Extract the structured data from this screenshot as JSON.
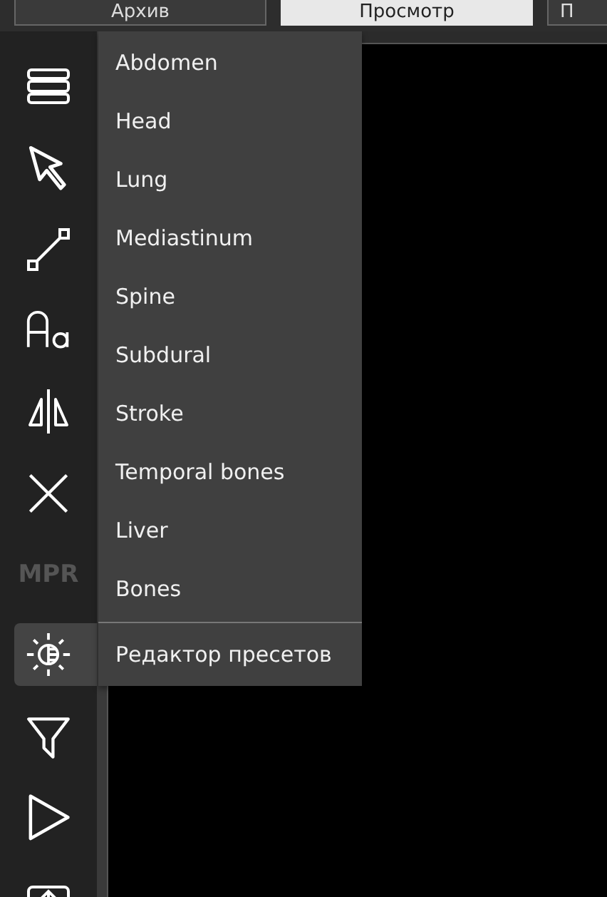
{
  "tabs": [
    {
      "label": "Архив",
      "selected": false
    },
    {
      "label": "Просмотр",
      "selected": true
    },
    {
      "label": "П",
      "selected": false
    }
  ],
  "toolbar": [
    {
      "kind": "icon",
      "selected": false,
      "disabled": false
    },
    {
      "kind": "icon",
      "selected": false,
      "disabled": false
    },
    {
      "kind": "icon",
      "selected": false,
      "disabled": false
    },
    {
      "kind": "icon",
      "selected": false,
      "disabled": false
    },
    {
      "kind": "icon",
      "selected": false,
      "disabled": false
    },
    {
      "kind": "icon",
      "selected": false,
      "disabled": false
    },
    {
      "kind": "text",
      "label": "MPR",
      "selected": false,
      "disabled": true
    },
    {
      "kind": "icon",
      "selected": true,
      "disabled": false
    },
    {
      "kind": "icon",
      "selected": false,
      "disabled": false
    },
    {
      "kind": "icon",
      "selected": false,
      "disabled": false
    },
    {
      "kind": "icon",
      "selected": false,
      "disabled": false
    }
  ],
  "preset_menu": {
    "items": [
      "Abdomen",
      "Head",
      "Lung",
      "Mediastinum",
      "Spine",
      "Subdural",
      "Stroke",
      "Temporal bones",
      "Liver",
      "Bones"
    ],
    "footer_item": "Редактор пресетов"
  }
}
